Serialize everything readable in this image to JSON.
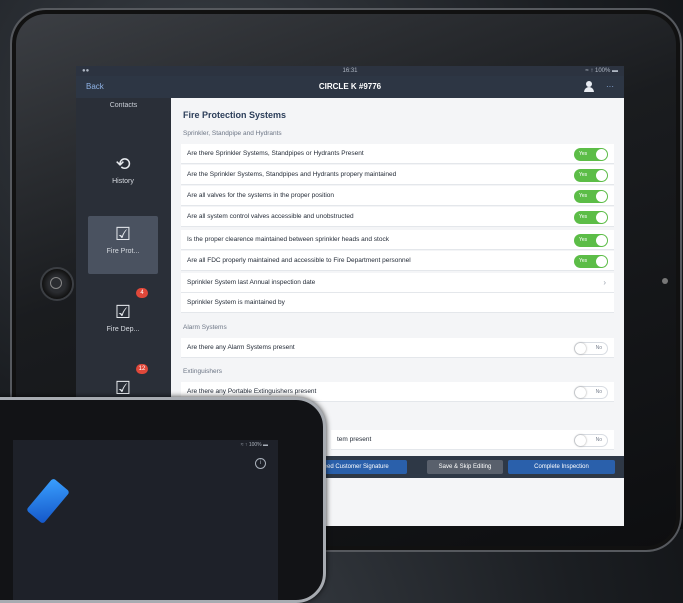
{
  "status_bar": {
    "left": "●●",
    "center": "16:31",
    "right": "≈ ↑ 100% ▬"
  },
  "nav": {
    "back": "Back",
    "title": "CIRCLE K #9776",
    "more": "···"
  },
  "sidebar": {
    "contacts": "Contacts",
    "items": [
      {
        "label": "History",
        "icon": "history-icon",
        "badge": ""
      },
      {
        "label": "Fire Prot...",
        "icon": "checkbox-icon",
        "badge": "",
        "active": true
      },
      {
        "label": "Fire Dep...",
        "icon": "checkbox-icon",
        "badge": "4"
      },
      {
        "label": "",
        "icon": "checkbox-icon",
        "badge": "12"
      }
    ]
  },
  "main": {
    "title": "Fire Protection Systems",
    "sections": [
      {
        "header": "Sprinkler, Standpipe and Hydrants",
        "rows": [
          {
            "label": "Are there Sprinkler Systems, Standpipes or Hydrants Present",
            "type": "toggle",
            "value": "Yes"
          },
          {
            "label": "Are the Sprinkler Systems, Standpipes and Hydrants propery maintained",
            "type": "toggle",
            "value": "Yes"
          },
          {
            "label": "Are all valves for the systems in the proper position",
            "type": "toggle",
            "value": "Yes"
          },
          {
            "label": "Are all system control valves accessible and unobstructed",
            "type": "toggle",
            "value": "Yes"
          },
          {
            "label": "Is the proper clearence maintained between sprinkler heads and stock",
            "type": "toggle",
            "value": "Yes"
          },
          {
            "label": "Are all FDC properly maintained and accessible to Fire Department personnel",
            "type": "toggle",
            "value": "Yes"
          },
          {
            "label": "Sprinkler System last Annual inspection date",
            "type": "chevron",
            "value": ""
          },
          {
            "label": "Sprinkler System is maintained by",
            "type": "text",
            "value": ""
          }
        ]
      },
      {
        "header": "Alarm Systems",
        "rows": [
          {
            "label": "Are there any Alarm Systems present",
            "type": "toggle-off",
            "value": "No"
          }
        ]
      },
      {
        "header": "Extinguishers",
        "rows": [
          {
            "label": "Are there any Portable Extinguishers present",
            "type": "toggle-off",
            "value": "No"
          }
        ]
      },
      {
        "header": "",
        "rows": [
          {
            "label": "tem present",
            "type": "toggle-off",
            "value": "No"
          }
        ]
      }
    ]
  },
  "bottom_bar": {
    "need_signature": "Need Customer Signature",
    "save_skip": "Save & Skip Editing",
    "complete": "Complete Inspection"
  },
  "phone": {
    "status": "≈ ↑ 100% ▬",
    "info": "i"
  },
  "colors": {
    "toggle_on": "#5cbd47",
    "accent_blue": "#2a60ab",
    "nav_bg": "#2d3644"
  }
}
